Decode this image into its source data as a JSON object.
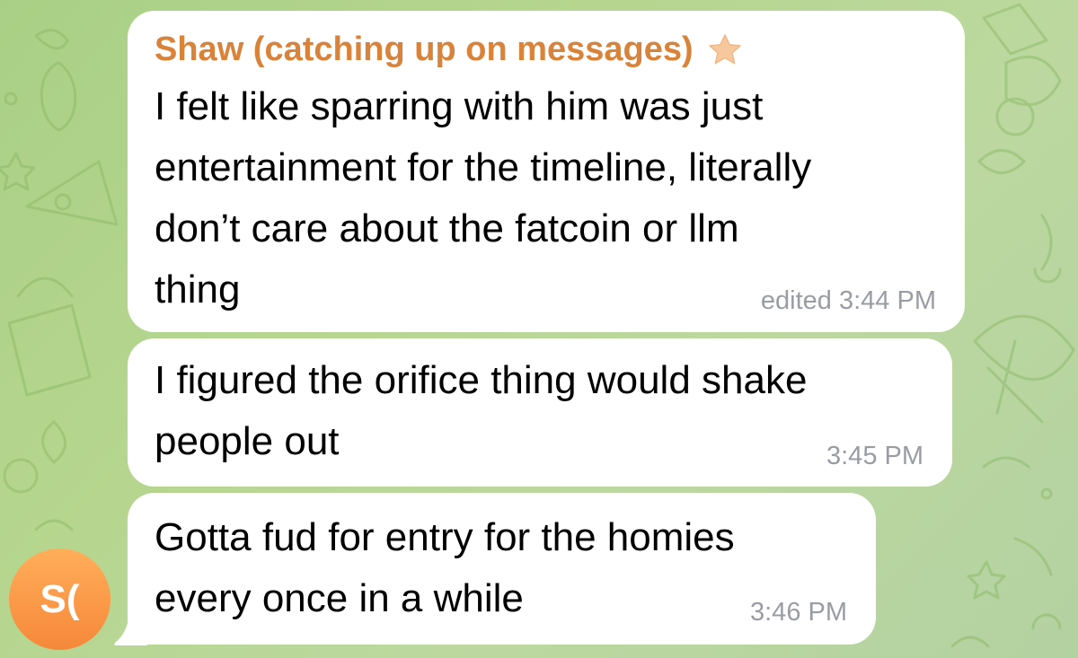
{
  "colors": {
    "sender_name": "#d9823a",
    "timestamp": "#999da3",
    "bubble": "#ffffff",
    "avatar": "#f6883a",
    "star": "#f7c89e"
  },
  "messages": [
    {
      "sender": "Shaw (catching up on messages)",
      "badge_icon": "star-icon",
      "lines": [
        "I felt like sparring with him was just",
        "entertainment for the timeline, literally",
        "don’t care about the fatcoin or llm",
        "thing"
      ],
      "time": "edited 3:44 PM"
    },
    {
      "lines": [
        "I figured the orifice thing would shake",
        "people out"
      ],
      "time": "3:45 PM"
    },
    {
      "lines": [
        "Gotta fud for entry for the homies",
        "every once in a while"
      ],
      "time": "3:46 PM"
    }
  ],
  "avatar": {
    "initials": "S("
  }
}
